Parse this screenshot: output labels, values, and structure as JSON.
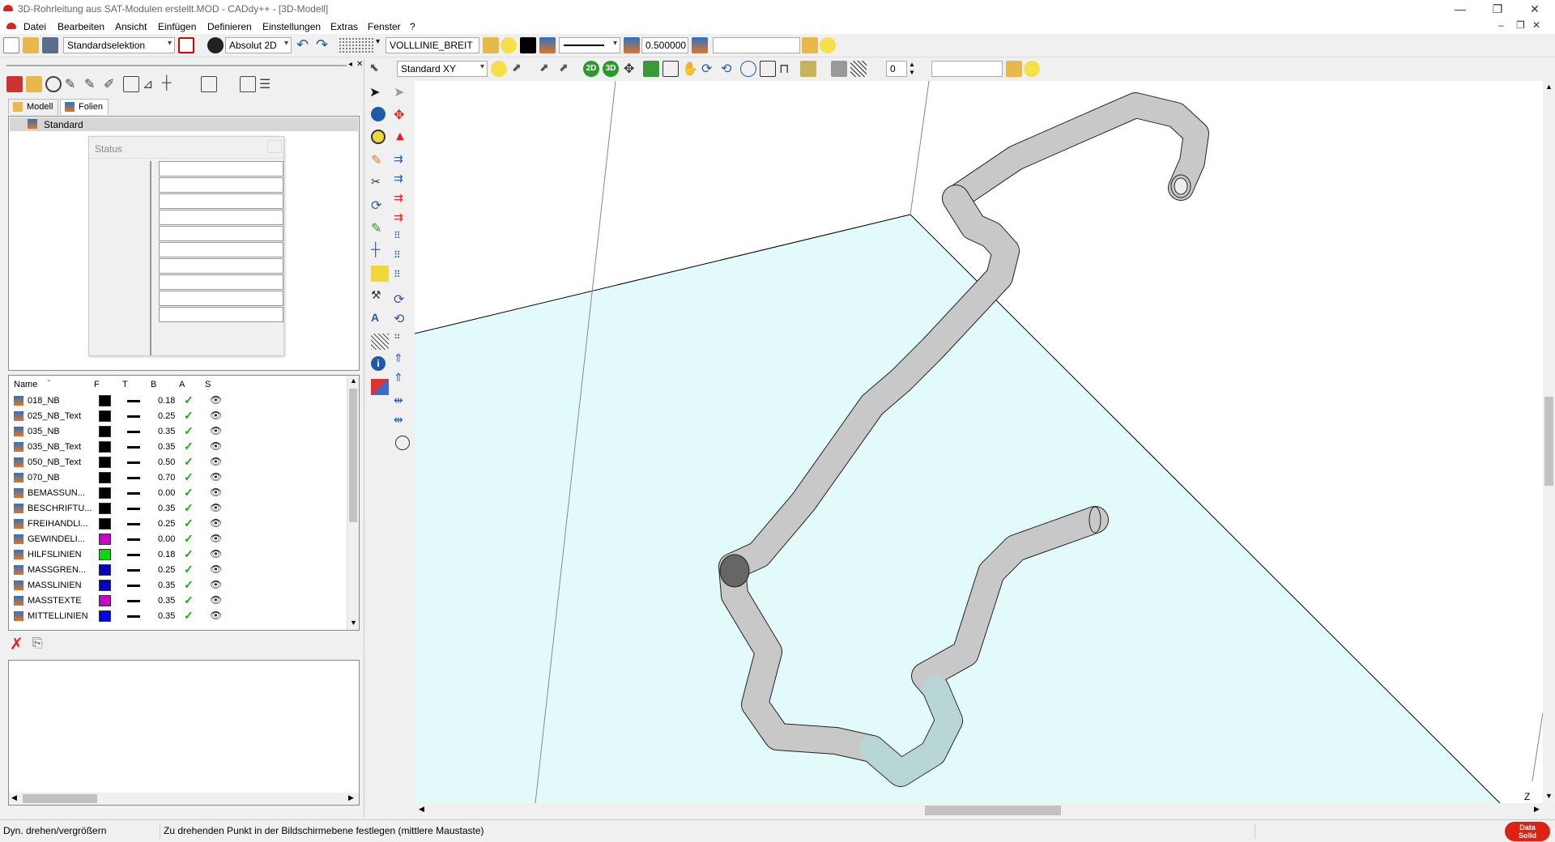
{
  "window": {
    "title": "3D-Rohrleitung aus SAT-Modulen erstellt.MOD  -  CADdy++ - [3D-Modell]",
    "minimize": "—",
    "restore": "❐",
    "close": "✕"
  },
  "menu": {
    "items": [
      "Datei",
      "Bearbeiten",
      "Ansicht",
      "Einfügen",
      "Definieren",
      "Einstellungen",
      "Extras",
      "Fenster",
      "?"
    ]
  },
  "toolbar1": {
    "selection_mode": "Standardselektion",
    "coord_mode": "Absolut 2D",
    "line_type": "VOLLLINIE_BREIT",
    "line_width": "0.500000",
    "search_value": ""
  },
  "toolbar2": {
    "view": "Standard XY",
    "label_2d": "2D",
    "label_3d": "3D",
    "layer_number": "0",
    "search_value": ""
  },
  "left_panel": {
    "tabs": [
      "Modell",
      "Folien"
    ],
    "tree_root": "Standard",
    "status_dialog_title": "Status"
  },
  "layers": {
    "columns": [
      "Name",
      "F",
      "T",
      "B",
      "A",
      "S"
    ],
    "rows": [
      {
        "name": "018_NB",
        "color": "#000000",
        "width": "0.18"
      },
      {
        "name": "025_NB_Text",
        "color": "#000000",
        "width": "0.25"
      },
      {
        "name": "035_NB",
        "color": "#000000",
        "width": "0.35"
      },
      {
        "name": "035_NB_Text",
        "color": "#000000",
        "width": "0.35"
      },
      {
        "name": "050_NB_Text",
        "color": "#000000",
        "width": "0.50"
      },
      {
        "name": "070_NB",
        "color": "#000000",
        "width": "0.70"
      },
      {
        "name": "BEMASSUN...",
        "color": "#000000",
        "width": "0.00"
      },
      {
        "name": "BESCHRIFTU...",
        "color": "#000000",
        "width": "0.35"
      },
      {
        "name": "FREIHANDLI...",
        "color": "#000000",
        "width": "0.25"
      },
      {
        "name": "GEWINDELI...",
        "color": "#cc00cc",
        "width": "0.00"
      },
      {
        "name": "HILFSLINIEN",
        "color": "#00dd00",
        "width": "0.18"
      },
      {
        "name": "MASSGREN...",
        "color": "#0000cc",
        "width": "0.25"
      },
      {
        "name": "MASSLINIEN",
        "color": "#0000cc",
        "width": "0.35"
      },
      {
        "name": "MASSTEXTE",
        "color": "#cc00cc",
        "width": "0.35"
      },
      {
        "name": "MITTELLINIEN",
        "color": "#0000ff",
        "width": "0.35"
      }
    ]
  },
  "viewport": {
    "axis_label": "Z",
    "plane_color": "#e3fafa",
    "pipe_color": "#c8c8c8",
    "pipe_highlight_color": "#b8d6d6"
  },
  "status_bar": {
    "mode": "Dyn. drehen/vergrößern",
    "hint": "Zu drehenden Punkt in der Bildschirmebene festlegen (mittlere Maustaste)",
    "logo_line1": "Data",
    "logo_line2": "Solid"
  }
}
